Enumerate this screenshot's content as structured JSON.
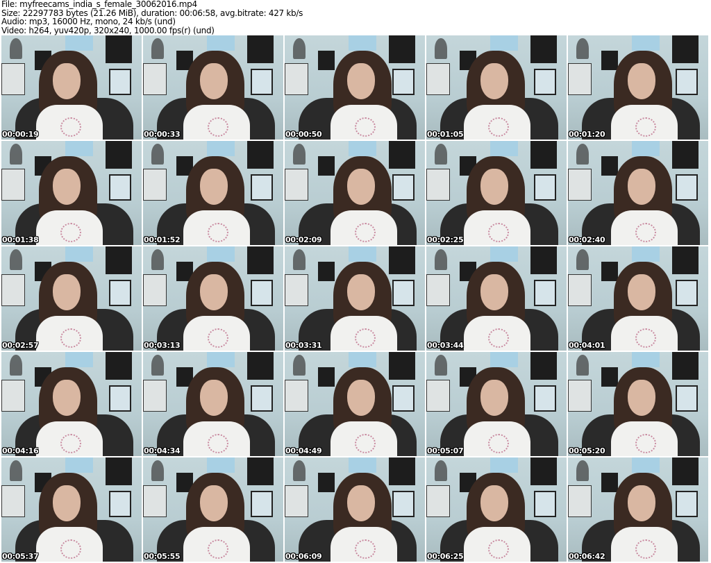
{
  "header": {
    "file": "File: myfreecams_india_s_female_30062016.mp4",
    "size": "Size: 22297783 bytes (21.26 MiB), duration: 00:06:58, avg.bitrate: 427 kb/s",
    "audio": "Audio: mp3, 16000 Hz, mono, 24 kb/s (und)",
    "video": "Video: h264, yuv420p, 320x240, 1000.00 fps(r) (und)"
  },
  "thumbnails": [
    "00:00:19",
    "00:00:33",
    "00:00:50",
    "00:01:05",
    "00:01:20",
    "00:01:38",
    "00:01:52",
    "00:02:09",
    "00:02:25",
    "00:02:40",
    "00:02:57",
    "00:03:13",
    "00:03:31",
    "00:03:44",
    "00:04:01",
    "00:04:16",
    "00:04:34",
    "00:04:49",
    "00:05:07",
    "00:05:20",
    "00:05:37",
    "00:05:55",
    "00:06:09",
    "00:06:25",
    "00:06:42"
  ]
}
